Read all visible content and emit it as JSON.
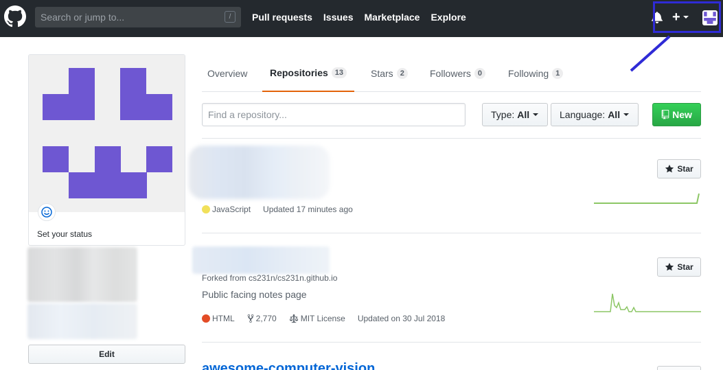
{
  "header": {
    "search_placeholder": "Search or jump to...",
    "slash_key": "/",
    "nav": [
      "Pull requests",
      "Issues",
      "Marketplace",
      "Explore"
    ]
  },
  "profile": {
    "status_text": "Set your status",
    "edit_label": "Edit"
  },
  "tabs": [
    {
      "label": "Overview",
      "count": null
    },
    {
      "label": "Repositories",
      "count": "13",
      "selected": true
    },
    {
      "label": "Stars",
      "count": "2"
    },
    {
      "label": "Followers",
      "count": "0"
    },
    {
      "label": "Following",
      "count": "1"
    }
  ],
  "filters": {
    "search_placeholder": "Find a repository...",
    "type_label": "Type:",
    "type_value": "All",
    "language_label": "Language:",
    "language_value": "All",
    "new_label": "New"
  },
  "repos": [
    {
      "language": "JavaScript",
      "language_color": "#f1e05a",
      "updated": "Updated 17 minutes ago",
      "star_label": "Star"
    },
    {
      "forked_from": "Forked from cs231n/cs231n.github.io",
      "description": "Public facing notes page",
      "language": "HTML",
      "language_color": "#e34c26",
      "forks": "2,770",
      "license": "MIT License",
      "updated": "Updated on 30 Jul 2018",
      "star_label": "Star"
    },
    {
      "title": "awesome-computer-vision"
    }
  ],
  "colors": {
    "header_bg": "#24292e",
    "identicon": "#6e57d2",
    "highlight": "#2f2bd6",
    "green": "#28a745",
    "tab_active": "#e36209"
  }
}
